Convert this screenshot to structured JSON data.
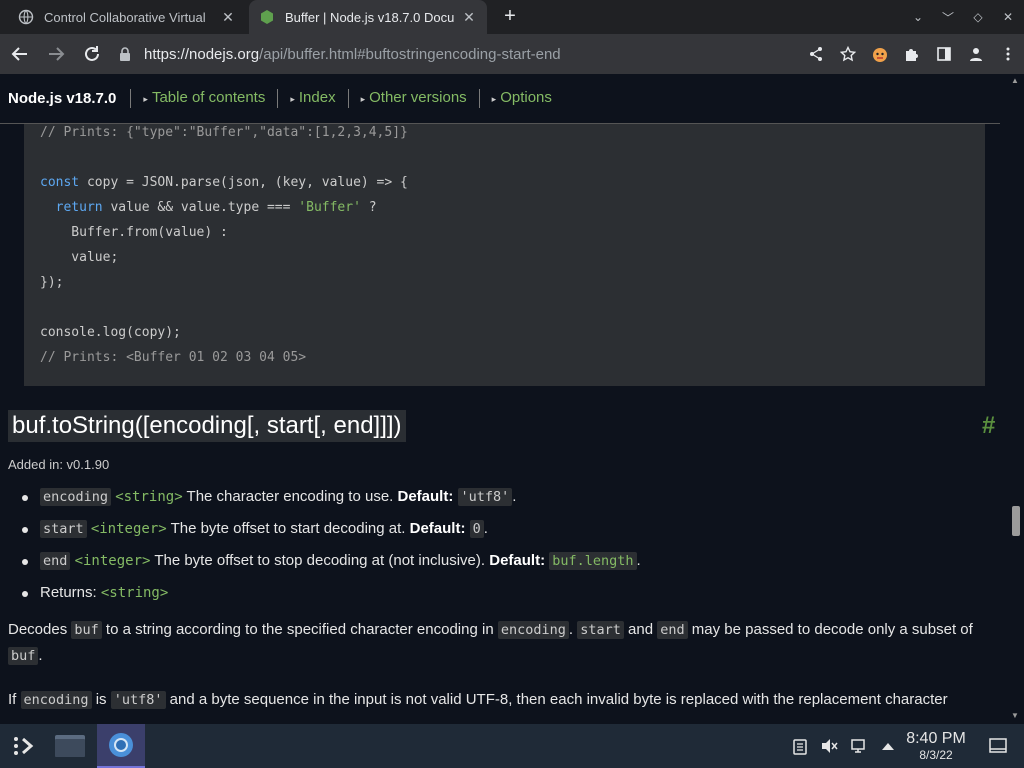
{
  "browser": {
    "tabs": [
      {
        "title": "Control Collaborative Virtual",
        "close": "✕",
        "active": false
      },
      {
        "title": "Buffer | Node.js v18.7.0 Docu",
        "close": "✕",
        "active": true
      }
    ],
    "new_tab": "+",
    "url_host": "https://nodejs.org",
    "url_rest": "/api/buffer.html#buftostringencoding-start-end"
  },
  "doc_header": {
    "title": "Node.js v18.7.0",
    "links": [
      "Table of contents",
      "Index",
      "Other versions",
      "Options"
    ]
  },
  "code": {
    "l1": "// Prints: {\"type\":\"Buffer\",\"data\":[1,2,3,4,5]}",
    "l3_kw": "const",
    "l3_rest": " copy = JSON.parse(json, (key, value) => {",
    "l4_kw": "return",
    "l4_mid": " value && value.type === ",
    "l4_str": "'Buffer'",
    "l4_end": " ?",
    "l5": "    Buffer.from(value) :",
    "l6": "    value;",
    "l7": "});",
    "l9": "console.log(copy);",
    "l10": "// Prints: <Buffer 01 02 03 04 05>"
  },
  "section": {
    "heading": "buf.toString([encoding[, start[, end]]])",
    "hash": "#",
    "added": "Added in: v0.1.90",
    "params": [
      {
        "name": "encoding",
        "type": "<string>",
        "desc": " The character encoding to use. ",
        "default_label": "Default:",
        "default": "'utf8'",
        "end": "."
      },
      {
        "name": "start",
        "type": "<integer>",
        "desc": " The byte offset to start decoding at. ",
        "default_label": "Default:",
        "default": "0",
        "end": "."
      },
      {
        "name": "end",
        "type": "<integer>",
        "desc": " The byte offset to stop decoding at (not inclusive). ",
        "default_label": "Default:",
        "default": "buf.length",
        "end": "."
      }
    ],
    "returns_label": "Returns: ",
    "returns_type": "<string>",
    "p1": {
      "t1": "Decodes ",
      "c1": "buf",
      "t2": " to a string according to the specified character encoding in ",
      "c2": "encoding",
      "t3": ". ",
      "c3": "start",
      "t4": " and ",
      "c4": "end",
      "t5": " may be passed to decode only a subset of",
      "c5": "buf",
      "t6": "."
    },
    "p2": {
      "t1": "If ",
      "c1": "encoding",
      "t2": " is ",
      "c2": "'utf8'",
      "t3": " and a byte sequence in the input is not valid UTF-8, then each invalid byte is replaced with the replacement character"
    }
  },
  "taskbar": {
    "time": "8:40 PM",
    "date": "8/3/22"
  }
}
